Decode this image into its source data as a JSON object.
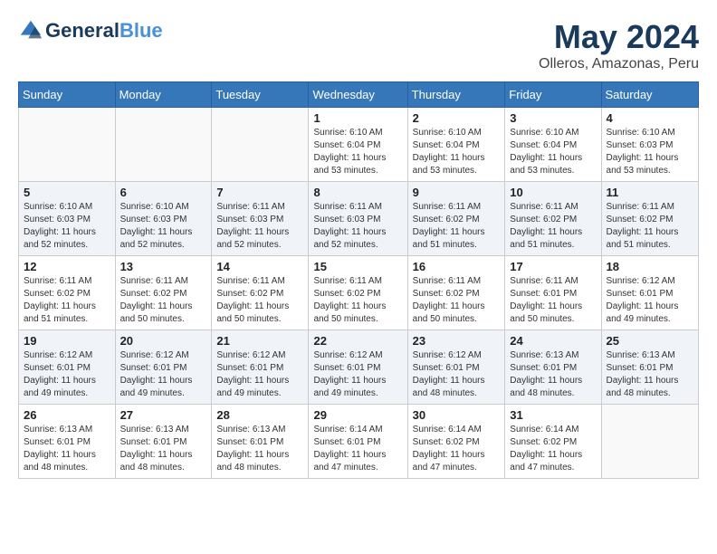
{
  "header": {
    "logo_line1": "General",
    "logo_line2": "Blue",
    "month": "May 2024",
    "location": "Olleros, Amazonas, Peru"
  },
  "days_of_week": [
    "Sunday",
    "Monday",
    "Tuesday",
    "Wednesday",
    "Thursday",
    "Friday",
    "Saturday"
  ],
  "weeks": [
    [
      {
        "num": "",
        "info": ""
      },
      {
        "num": "",
        "info": ""
      },
      {
        "num": "",
        "info": ""
      },
      {
        "num": "1",
        "info": "Sunrise: 6:10 AM\nSunset: 6:04 PM\nDaylight: 11 hours and 53 minutes."
      },
      {
        "num": "2",
        "info": "Sunrise: 6:10 AM\nSunset: 6:04 PM\nDaylight: 11 hours and 53 minutes."
      },
      {
        "num": "3",
        "info": "Sunrise: 6:10 AM\nSunset: 6:04 PM\nDaylight: 11 hours and 53 minutes."
      },
      {
        "num": "4",
        "info": "Sunrise: 6:10 AM\nSunset: 6:03 PM\nDaylight: 11 hours and 53 minutes."
      }
    ],
    [
      {
        "num": "5",
        "info": "Sunrise: 6:10 AM\nSunset: 6:03 PM\nDaylight: 11 hours and 52 minutes."
      },
      {
        "num": "6",
        "info": "Sunrise: 6:10 AM\nSunset: 6:03 PM\nDaylight: 11 hours and 52 minutes."
      },
      {
        "num": "7",
        "info": "Sunrise: 6:11 AM\nSunset: 6:03 PM\nDaylight: 11 hours and 52 minutes."
      },
      {
        "num": "8",
        "info": "Sunrise: 6:11 AM\nSunset: 6:03 PM\nDaylight: 11 hours and 52 minutes."
      },
      {
        "num": "9",
        "info": "Sunrise: 6:11 AM\nSunset: 6:02 PM\nDaylight: 11 hours and 51 minutes."
      },
      {
        "num": "10",
        "info": "Sunrise: 6:11 AM\nSunset: 6:02 PM\nDaylight: 11 hours and 51 minutes."
      },
      {
        "num": "11",
        "info": "Sunrise: 6:11 AM\nSunset: 6:02 PM\nDaylight: 11 hours and 51 minutes."
      }
    ],
    [
      {
        "num": "12",
        "info": "Sunrise: 6:11 AM\nSunset: 6:02 PM\nDaylight: 11 hours and 51 minutes."
      },
      {
        "num": "13",
        "info": "Sunrise: 6:11 AM\nSunset: 6:02 PM\nDaylight: 11 hours and 50 minutes."
      },
      {
        "num": "14",
        "info": "Sunrise: 6:11 AM\nSunset: 6:02 PM\nDaylight: 11 hours and 50 minutes."
      },
      {
        "num": "15",
        "info": "Sunrise: 6:11 AM\nSunset: 6:02 PM\nDaylight: 11 hours and 50 minutes."
      },
      {
        "num": "16",
        "info": "Sunrise: 6:11 AM\nSunset: 6:02 PM\nDaylight: 11 hours and 50 minutes."
      },
      {
        "num": "17",
        "info": "Sunrise: 6:11 AM\nSunset: 6:01 PM\nDaylight: 11 hours and 50 minutes."
      },
      {
        "num": "18",
        "info": "Sunrise: 6:12 AM\nSunset: 6:01 PM\nDaylight: 11 hours and 49 minutes."
      }
    ],
    [
      {
        "num": "19",
        "info": "Sunrise: 6:12 AM\nSunset: 6:01 PM\nDaylight: 11 hours and 49 minutes."
      },
      {
        "num": "20",
        "info": "Sunrise: 6:12 AM\nSunset: 6:01 PM\nDaylight: 11 hours and 49 minutes."
      },
      {
        "num": "21",
        "info": "Sunrise: 6:12 AM\nSunset: 6:01 PM\nDaylight: 11 hours and 49 minutes."
      },
      {
        "num": "22",
        "info": "Sunrise: 6:12 AM\nSunset: 6:01 PM\nDaylight: 11 hours and 49 minutes."
      },
      {
        "num": "23",
        "info": "Sunrise: 6:12 AM\nSunset: 6:01 PM\nDaylight: 11 hours and 48 minutes."
      },
      {
        "num": "24",
        "info": "Sunrise: 6:13 AM\nSunset: 6:01 PM\nDaylight: 11 hours and 48 minutes."
      },
      {
        "num": "25",
        "info": "Sunrise: 6:13 AM\nSunset: 6:01 PM\nDaylight: 11 hours and 48 minutes."
      }
    ],
    [
      {
        "num": "26",
        "info": "Sunrise: 6:13 AM\nSunset: 6:01 PM\nDaylight: 11 hours and 48 minutes."
      },
      {
        "num": "27",
        "info": "Sunrise: 6:13 AM\nSunset: 6:01 PM\nDaylight: 11 hours and 48 minutes."
      },
      {
        "num": "28",
        "info": "Sunrise: 6:13 AM\nSunset: 6:01 PM\nDaylight: 11 hours and 48 minutes."
      },
      {
        "num": "29",
        "info": "Sunrise: 6:14 AM\nSunset: 6:01 PM\nDaylight: 11 hours and 47 minutes."
      },
      {
        "num": "30",
        "info": "Sunrise: 6:14 AM\nSunset: 6:02 PM\nDaylight: 11 hours and 47 minutes."
      },
      {
        "num": "31",
        "info": "Sunrise: 6:14 AM\nSunset: 6:02 PM\nDaylight: 11 hours and 47 minutes."
      },
      {
        "num": "",
        "info": ""
      }
    ]
  ]
}
